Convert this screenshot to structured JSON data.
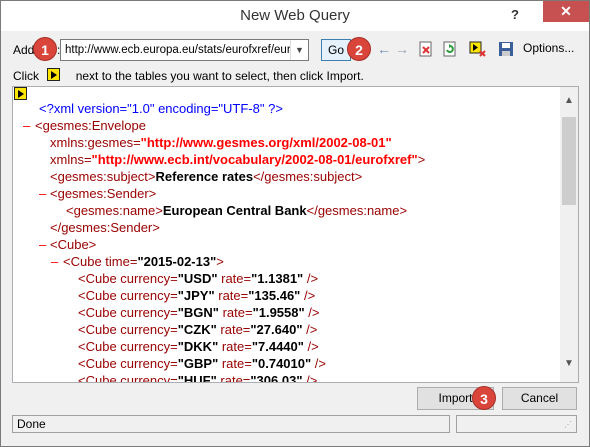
{
  "window": {
    "title": "New Web Query",
    "help": "?",
    "close": "✕"
  },
  "toolbar": {
    "address_label": "Address:",
    "address_value": "http://www.ecb.europa.eu/stats/eurofxref/eurofxref-daily.xml",
    "go_label": "Go",
    "options_label": "Options...",
    "icons": [
      "back-arrow-icon",
      "forward-arrow-icon",
      "stop-icon",
      "refresh-icon",
      "hide-icons-icon",
      "save-query-icon"
    ]
  },
  "instruction": {
    "before": "Click",
    "after": "next to the tables you want to select, then click Import."
  },
  "badges": {
    "b1": "1",
    "b2": "2",
    "b3": "3"
  },
  "xml": {
    "decl": "<?xml version=\"1.0\" encoding=\"UTF-8\" ?>",
    "dash": "–",
    "env_open": "<gesmes:Envelope",
    "xmlns_gesmes_attr": "xmlns:gesmes=",
    "xmlns_gesmes_val": "\"http://www.gesmes.org/xml/2002-08-01\"",
    "xmlns_attr": "xmlns=",
    "xmlns_val": "\"http://www.ecb.int/vocabulary/2002-08-01/eurofxref\"",
    "xmlns_close": ">",
    "subject_open": "<gesmes:subject>",
    "subject_text": "Reference rates",
    "subject_close": "</gesmes:subject>",
    "sender_open": "<gesmes:Sender>",
    "name_open": "<gesmes:name>",
    "name_text": "European Central Bank",
    "name_close": "</gesmes:name>",
    "sender_close": "</gesmes:Sender>",
    "cube_open": "<Cube>",
    "cube_time_open": "<Cube time=",
    "cube_time_val": "\"2015-02-13\"",
    "cube_time_close": ">",
    "rate_rows": [
      {
        "cur": "\"USD\"",
        "rate": "\"1.1381\""
      },
      {
        "cur": "\"JPY\"",
        "rate": "\"135.46\""
      },
      {
        "cur": "\"BGN\"",
        "rate": "\"1.9558\""
      },
      {
        "cur": "\"CZK\"",
        "rate": "\"27.640\""
      },
      {
        "cur": "\"DKK\"",
        "rate": "\"7.4440\""
      },
      {
        "cur": "\"GBP\"",
        "rate": "\"0.74010\""
      },
      {
        "cur": "\"HUF\"",
        "rate": "\"306.03\""
      }
    ],
    "row_prefix": "<Cube currency=",
    "row_mid": " rate=",
    "row_suffix": " />"
  },
  "buttons": {
    "import": "Import",
    "cancel": "Cancel"
  },
  "status": {
    "text": "Done"
  },
  "colors": {
    "badge": "#d9453b",
    "close": "#c75050",
    "tag": "#990000",
    "value": "#ff0000",
    "pi": "#0000ff"
  }
}
